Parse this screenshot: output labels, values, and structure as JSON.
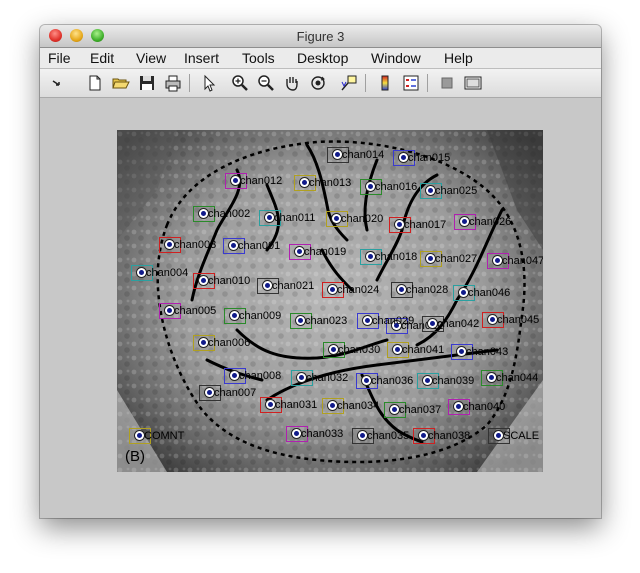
{
  "window": {
    "title": "Figure 3"
  },
  "menu": [
    "File",
    "Edit",
    "View",
    "Insert",
    "Tools",
    "Desktop",
    "Window",
    "Help"
  ],
  "toolbar": {
    "icons": [
      "arrow-icon",
      "new-file-icon",
      "open-folder-icon",
      "save-icon",
      "print-icon",
      "pointer-icon",
      "zoom-in-icon",
      "zoom-out-icon",
      "pan-hand-icon",
      "rotate-3d-icon",
      "data-cursor-icon",
      "colorbar-icon",
      "legend-icon",
      "hide-plot-tools-icon",
      "show-plot-tools-icon"
    ]
  },
  "figure": {
    "panel_label": "(B)",
    "electrodes": [
      {
        "label": "chan001",
        "color": "#3a3ad0"
      },
      {
        "label": "chan002",
        "color": "#2a8a2a"
      },
      {
        "label": "chan003",
        "color": "#d02020"
      },
      {
        "label": "chan004",
        "color": "#2aa0a0"
      },
      {
        "label": "chan005",
        "color": "#b020b0"
      },
      {
        "label": "chan006",
        "color": "#b0a020"
      },
      {
        "label": "chan007",
        "color": "#333333"
      },
      {
        "label": "chan008",
        "color": "#3a3ad0"
      },
      {
        "label": "chan009",
        "color": "#2a8a2a"
      },
      {
        "label": "chan010",
        "color": "#d02020"
      },
      {
        "label": "chan011",
        "color": "#2aa0a0"
      },
      {
        "label": "chan012",
        "color": "#b020b0"
      },
      {
        "label": "chan013",
        "color": "#b0a020"
      },
      {
        "label": "chan014",
        "color": "#333333"
      },
      {
        "label": "chan015",
        "color": "#3a3ad0"
      },
      {
        "label": "chan016",
        "color": "#2a8a2a"
      },
      {
        "label": "chan017",
        "color": "#d02020"
      },
      {
        "label": "chan018",
        "color": "#2aa0a0"
      },
      {
        "label": "chan019",
        "color": "#b020b0"
      },
      {
        "label": "chan020",
        "color": "#b0a020"
      },
      {
        "label": "chan021",
        "color": "#333333"
      },
      {
        "label": "chan022",
        "color": "#3a3ad0"
      },
      {
        "label": "chan023",
        "color": "#2a8a2a"
      },
      {
        "label": "chan024",
        "color": "#d02020"
      },
      {
        "label": "chan025",
        "color": "#2aa0a0"
      },
      {
        "label": "chan026",
        "color": "#b020b0"
      },
      {
        "label": "chan027",
        "color": "#b0a020"
      },
      {
        "label": "chan028",
        "color": "#333333"
      },
      {
        "label": "chan029",
        "color": "#3a3ad0"
      },
      {
        "label": "chan030",
        "color": "#2a8a2a"
      },
      {
        "label": "chan031",
        "color": "#d02020"
      },
      {
        "label": "chan032",
        "color": "#2aa0a0"
      },
      {
        "label": "chan033",
        "color": "#b020b0"
      },
      {
        "label": "chan034",
        "color": "#b0a020"
      },
      {
        "label": "chan035",
        "color": "#333333"
      },
      {
        "label": "chan036",
        "color": "#3a3ad0"
      },
      {
        "label": "chan037",
        "color": "#2a8a2a"
      },
      {
        "label": "chan038",
        "color": "#d02020"
      },
      {
        "label": "chan039",
        "color": "#2aa0a0"
      },
      {
        "label": "chan040",
        "color": "#b020b0"
      },
      {
        "label": "chan041",
        "color": "#b0a020"
      },
      {
        "label": "chan042",
        "color": "#333333"
      },
      {
        "label": "chan043",
        "color": "#3a3ad0"
      },
      {
        "label": "chan044",
        "color": "#2a8a2a"
      },
      {
        "label": "chan045",
        "color": "#d02020"
      },
      {
        "label": "chan046",
        "color": "#2aa0a0"
      },
      {
        "label": "chan047",
        "color": "#b020b0"
      },
      {
        "label": "COMNT",
        "color": "#b0a020"
      },
      {
        "label": "SCALE",
        "color": "#333333"
      }
    ]
  }
}
